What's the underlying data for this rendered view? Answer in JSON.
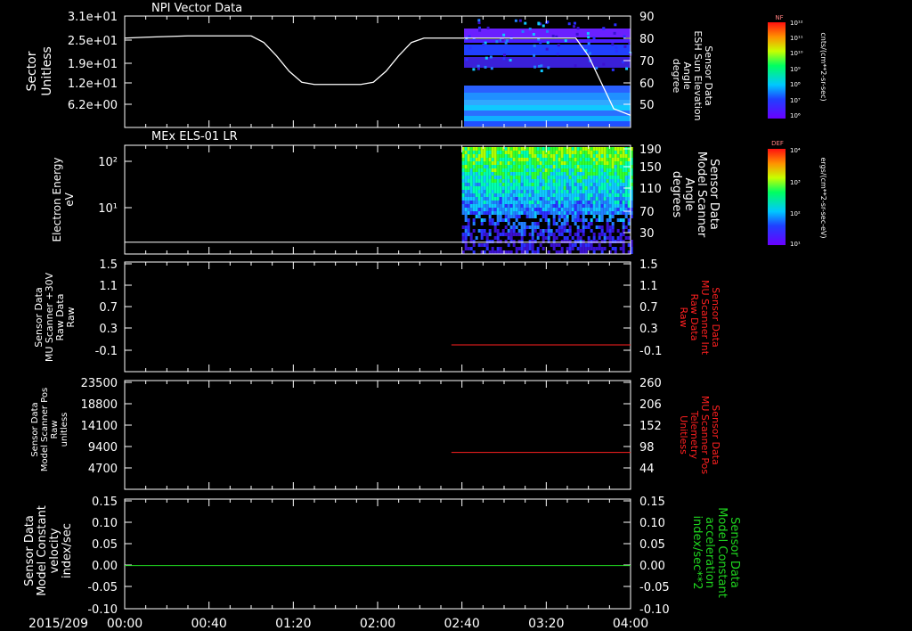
{
  "colors": {
    "background": "#000000",
    "axis": "#ffffff",
    "red": "#ff2020",
    "green": "#1fd41f"
  },
  "time_axis": {
    "date_label": "2015/209",
    "ticks": [
      "00:00",
      "00:40",
      "01:20",
      "02:00",
      "02:40",
      "03:20",
      "04:00"
    ],
    "tick_minutes": [
      0,
      40,
      80,
      120,
      160,
      200,
      240
    ]
  },
  "panels": [
    {
      "id": "npi",
      "title": "NPI Vector Data",
      "left_label": [
        "Sector",
        "Unitless"
      ],
      "left_ticks": [
        "3.1e+01",
        "2.5e+01",
        "1.9e+01",
        "1.2e+01",
        "6.2e+00"
      ],
      "right_label": [
        "Sensor Data",
        "ESH Sun Elevation",
        "Angle",
        "degree"
      ],
      "right_ticks": [
        "90",
        "80",
        "70",
        "60",
        "50"
      ],
      "colorbar": {
        "label": "NF",
        "unit": "cnts/(cm**2-sr-sec)",
        "ticks": [
          "10¹²",
          "10¹¹",
          "10¹⁰",
          "10⁹",
          "10⁸",
          "10⁷",
          "10⁶"
        ]
      }
    },
    {
      "id": "els",
      "title": "MEx ELS-01 LR",
      "left_label": [
        "Electron Energy",
        "eV"
      ],
      "left_ticks": [
        "10²",
        "10¹"
      ],
      "right_label": [
        "Sensor Data",
        "Model Scanner",
        "Angle",
        "degrees"
      ],
      "right_ticks": [
        "190",
        "150",
        "110",
        "70",
        "30"
      ],
      "colorbar": {
        "label": "DEF",
        "unit": "ergs/(cm**2-sr-sec-eV)",
        "ticks": [
          "10⁴",
          "10³",
          "10²",
          "10¹"
        ]
      }
    },
    {
      "id": "mu_int",
      "left_label": [
        "Sensor Data",
        "MU Scanner +30V",
        "Raw Data",
        "Raw"
      ],
      "left_ticks": [
        "1.5",
        "1.1",
        "0.7",
        "0.3",
        "-0.1"
      ],
      "right_label": [
        "Sensor Data",
        "MU Scanner Int",
        "Raw Data",
        "Raw"
      ],
      "right_ticks": [
        "1.5",
        "1.1",
        "0.7",
        "0.3",
        "-0.1"
      ]
    },
    {
      "id": "mu_pos",
      "left_label": [
        "Sensor Data",
        "Model Scanner Pos",
        "Raw",
        "unitless"
      ],
      "left_ticks": [
        "23500",
        "18800",
        "14100",
        "9400",
        "4700"
      ],
      "right_label": [
        "Sensor Data",
        "MU Scanner Pos",
        "Telemetry",
        "Unitless"
      ],
      "right_ticks": [
        "260",
        "206",
        "152",
        "98",
        "44"
      ]
    },
    {
      "id": "model_const",
      "left_label": [
        "Sensor Data",
        "Model Constant",
        "velocity",
        "index/sec"
      ],
      "left_ticks": [
        "0.15",
        "0.10",
        "0.05",
        "0.00",
        "-0.05",
        "-0.10"
      ],
      "right_label": [
        "Sensor Data",
        "Model Constant",
        "acceleration",
        "index/sec**2"
      ],
      "right_ticks": [
        "0.15",
        "0.10",
        "0.05",
        "0.00",
        "-0.05",
        "-0.10"
      ]
    }
  ],
  "chart_data": [
    {
      "type": "line",
      "panel": "npi",
      "series": [
        {
          "y_axis": "right",
          "x_minutes": [
            0,
            10,
            30,
            60,
            66,
            72,
            78,
            84,
            90,
            112,
            118,
            124,
            130,
            136,
            142,
            160,
            200,
            214,
            220,
            226,
            232,
            240
          ],
          "y_degrees": [
            80,
            80.4,
            81,
            81,
            78,
            72,
            65,
            60,
            59,
            59,
            60,
            65,
            72,
            78,
            80,
            80,
            80,
            80,
            72,
            60,
            48,
            45
          ]
        }
      ],
      "spectrogram_coverage_minutes": [
        161,
        240
      ]
    },
    {
      "type": "line",
      "panel": "els",
      "series": [
        {
          "y_axis": "left",
          "x_minutes": [
            0,
            240
          ],
          "y_eV": [
            1.8,
            1.8
          ]
        }
      ],
      "spectrogram_coverage_minutes": [
        160,
        240
      ]
    },
    {
      "type": "line",
      "panel": "mu_int",
      "series": [
        {
          "y_axis": "right",
          "x_minutes": [
            155,
            240
          ],
          "y_raw": [
            0,
            0
          ]
        }
      ]
    },
    {
      "type": "line",
      "panel": "mu_pos",
      "series": [
        {
          "y_axis": "right",
          "x_minutes": [
            155,
            240
          ],
          "y_unitless": [
            83,
            83
          ]
        }
      ]
    },
    {
      "type": "line",
      "panel": "model_const",
      "series": [
        {
          "y_axis": "left",
          "x_minutes": [
            0,
            240
          ],
          "y_index_per_sec": [
            0,
            0
          ]
        }
      ]
    }
  ]
}
